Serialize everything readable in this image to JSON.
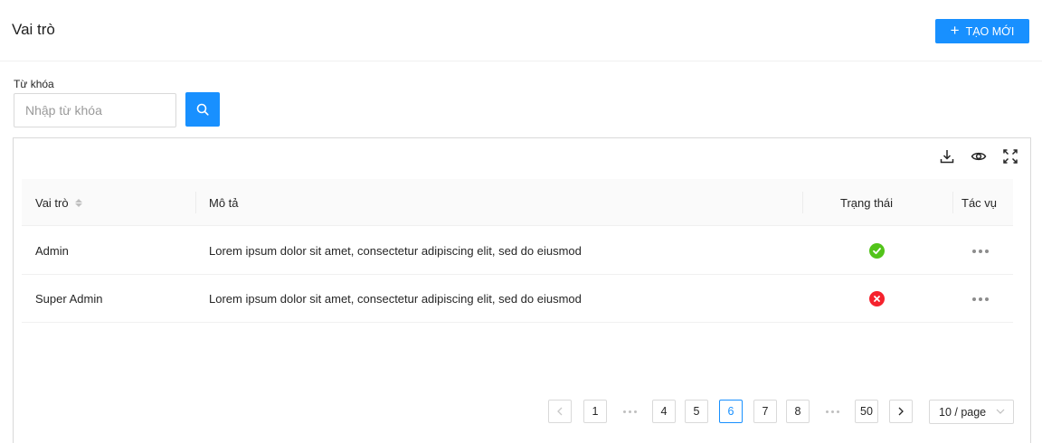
{
  "header": {
    "title": "Vai trò",
    "create_label": "TẠO MỚI"
  },
  "search": {
    "label": "Từ khóa",
    "placeholder": "Nhập từ khóa",
    "value": ""
  },
  "toolbar": {
    "icons": [
      "download-icon",
      "eye-icon",
      "fullscreen-icon"
    ]
  },
  "table": {
    "columns": {
      "role": "Vai trò",
      "description": "Mô tả",
      "status": "Trạng thái",
      "actions": "Tác vụ"
    },
    "rows": [
      {
        "role": "Admin",
        "description": "Lorem ipsum dolor sit amet, consectetur adipiscing elit, sed do eiusmod",
        "status": "active"
      },
      {
        "role": "Super Admin",
        "description": "Lorem ipsum dolor sit amet, consectetur adipiscing elit, sed do eiusmod",
        "status": "inactive"
      }
    ]
  },
  "pagination": {
    "pages": [
      "1",
      "4",
      "5",
      "6",
      "7",
      "8",
      "50"
    ],
    "current": "6",
    "page_size": "10 / page"
  },
  "colors": {
    "primary": "#1890ff",
    "success": "#52c41a",
    "error": "#f5222d"
  }
}
